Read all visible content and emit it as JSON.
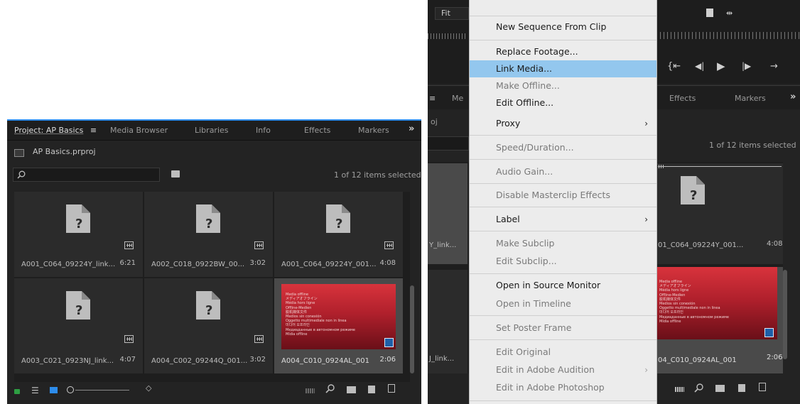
{
  "left_panel": {
    "tabs": [
      {
        "label": "Project: AP Basics",
        "menu_glyph": "≡"
      },
      {
        "label": "Media Browser"
      },
      {
        "label": "Libraries"
      },
      {
        "label": "Info"
      },
      {
        "label": "Effects"
      },
      {
        "label": "Markers"
      }
    ],
    "overflow_glyph": "»",
    "project_file": "AP Basics.prproj",
    "search_placeholder": "",
    "selection_status": "1 of 12 items selected",
    "clips": [
      {
        "name": "A001_C064_09224Y_link...",
        "duration": "6:21",
        "offline": true
      },
      {
        "name": "A002_C018_0922BW_00...",
        "duration": "3:02",
        "offline": true
      },
      {
        "name": "A001_C064_09224Y_001...",
        "duration": "4:08",
        "offline": true
      },
      {
        "name": "A003_C021_0923NJ_link...",
        "duration": "4:07",
        "offline": true
      },
      {
        "name": "A004_C002_09244Q_001...",
        "duration": "3:02",
        "offline": true
      },
      {
        "name": "A004_C010_0924AL_001",
        "duration": "2:06",
        "offline": false,
        "selected": true
      }
    ],
    "media_offline_lines": [
      "Media offline",
      "メディアオフライン",
      "Média hors ligne",
      "Offline-Medien",
      "脱机媒体文件",
      "Medios sin conexión",
      "Oggetto multimediale non in linea",
      "미디어 오프라인",
      "Медиаданные в автономном режиме",
      "Mídia offline"
    ]
  },
  "right_panel": {
    "zoom_label": "Fit",
    "tabs_left": [
      "Me"
    ],
    "tabs_right": [
      "Effects",
      "Markers"
    ],
    "overflow_glyph": "»",
    "project_abbrev": "oj",
    "selection_status": "1 of 12 items selected",
    "clips": [
      {
        "name": "01_C064_09224Y_001...",
        "duration": "4:08"
      },
      {
        "name": "04_C010_0924AL_001",
        "duration": "2:06"
      }
    ],
    "left_clip_fragments": [
      "Y_link...",
      "J_link..."
    ]
  },
  "context_menu": {
    "items": [
      {
        "label": "New Sequence From Clip",
        "enabled": true
      },
      {
        "label": "Replace Footage...",
        "enabled": true
      },
      {
        "label": "Link Media...",
        "enabled": true,
        "highlighted": true
      },
      {
        "label": "Make Offline...",
        "enabled": false
      },
      {
        "label": "Edit Offline...",
        "enabled": true
      },
      {
        "label": "Proxy",
        "enabled": true,
        "submenu": true
      },
      {
        "label": "Speed/Duration...",
        "enabled": false
      },
      {
        "label": "Audio Gain...",
        "enabled": false
      },
      {
        "label": "Disable Masterclip Effects",
        "enabled": false
      },
      {
        "label": "Label",
        "enabled": true,
        "submenu": true
      },
      {
        "label": "Make Subclip",
        "enabled": false
      },
      {
        "label": "Edit Subclip...",
        "enabled": false
      },
      {
        "label": "Open in Source Monitor",
        "enabled": true
      },
      {
        "label": "Open in Timeline",
        "enabled": false
      },
      {
        "label": "Set Poster Frame",
        "enabled": false
      },
      {
        "label": "Edit Original",
        "enabled": false
      },
      {
        "label": "Edit in Adobe Audition",
        "enabled": false,
        "submenu": true
      },
      {
        "label": "Edit in Adobe Photoshop",
        "enabled": false
      }
    ]
  },
  "colors": {
    "panel_bg": "#232323",
    "thumb_bg": "#2b2b2b",
    "menu_bg": "#ececec",
    "menu_highlight": "#93c7ee",
    "accent_blue": "#2d8ceb",
    "lock_green": "#2ea043",
    "offline_red": "#c8202c"
  }
}
